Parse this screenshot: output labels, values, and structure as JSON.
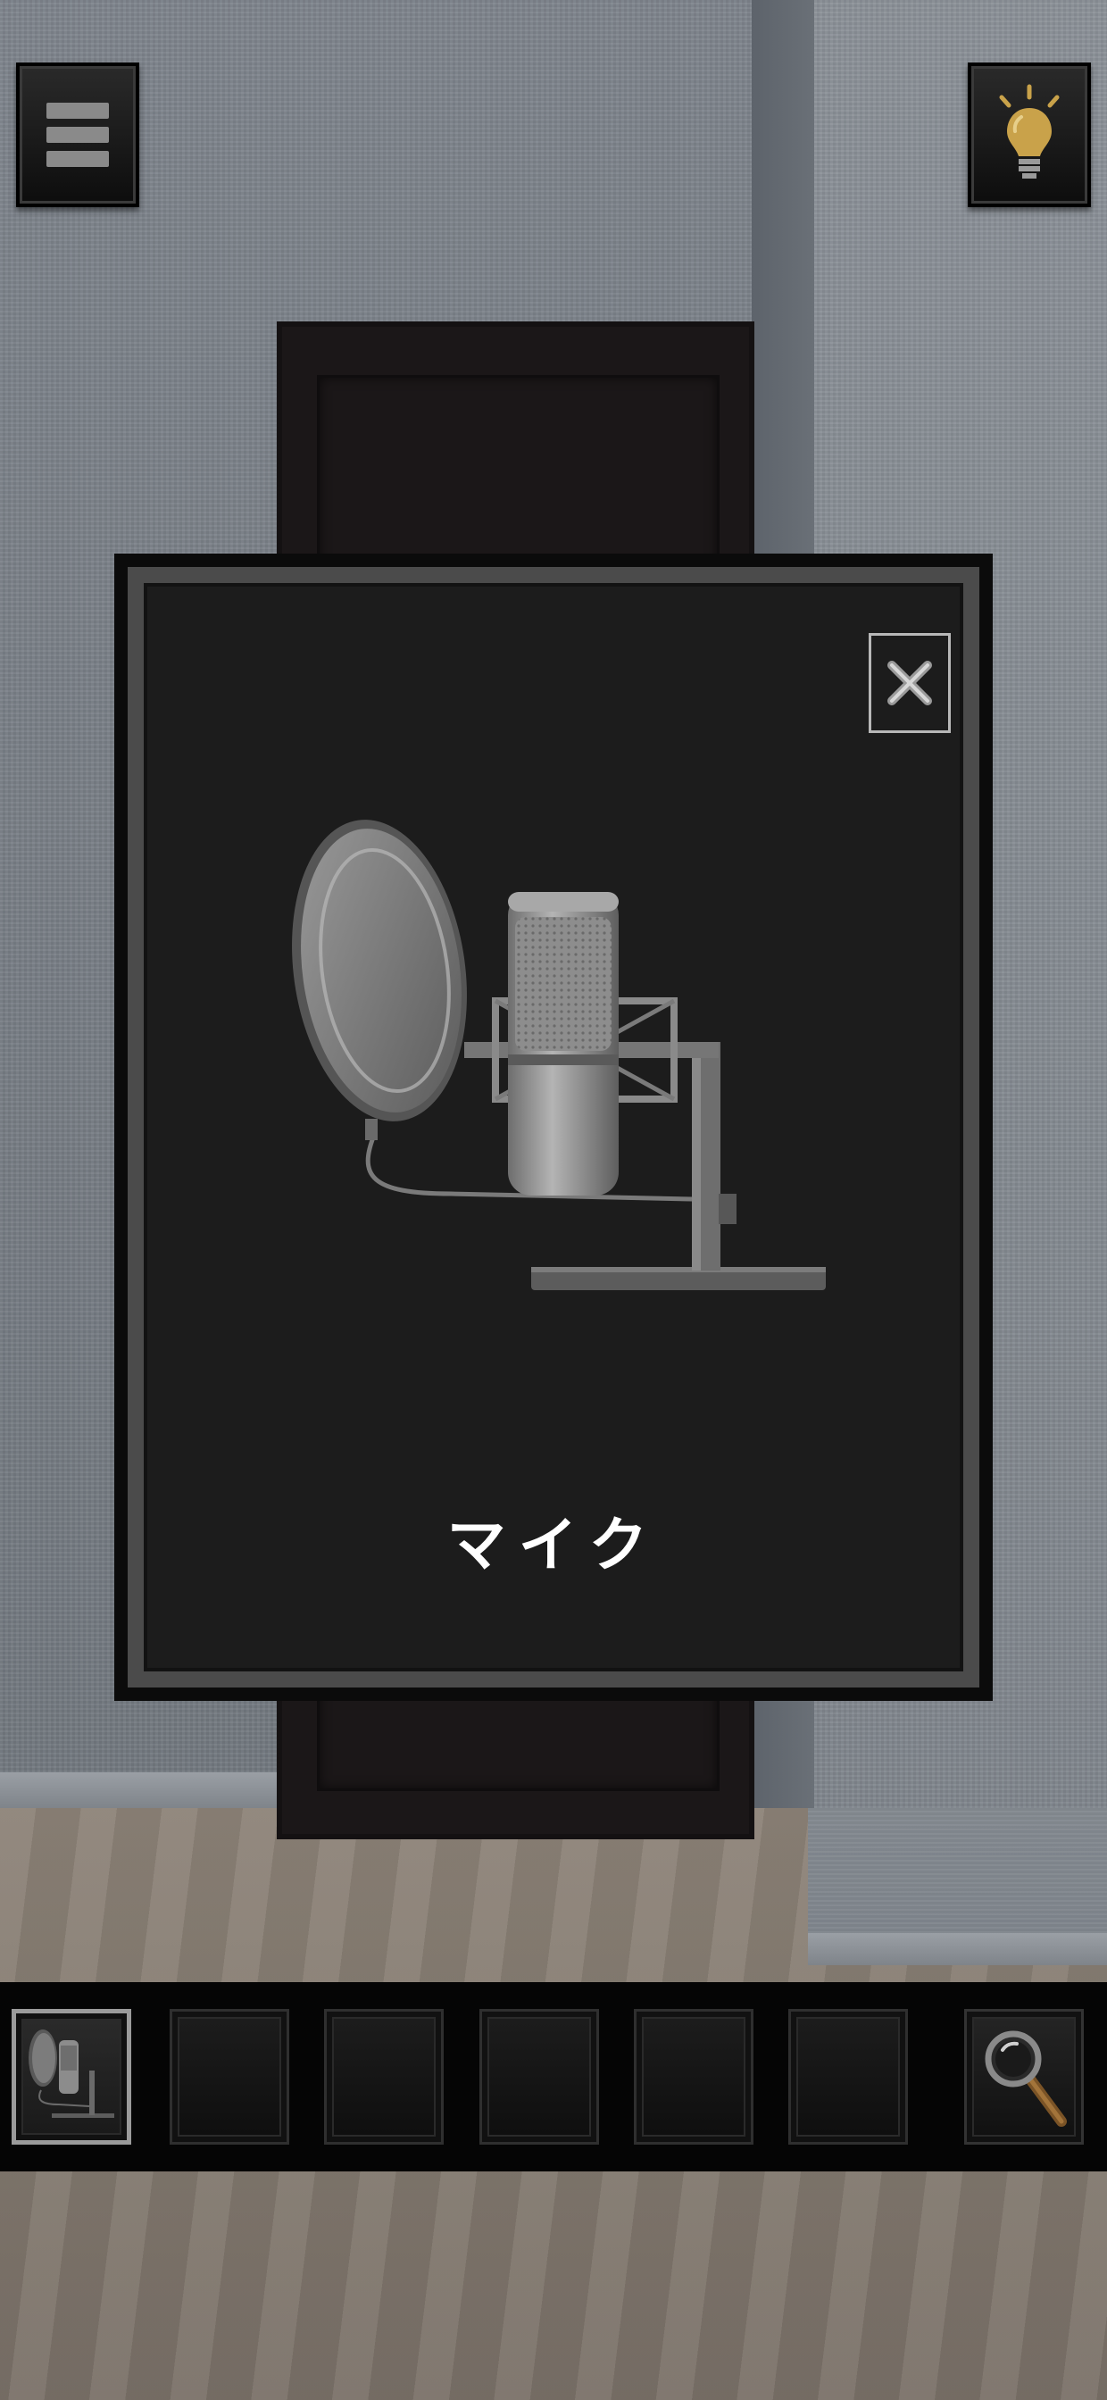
{
  "popup": {
    "item_name": "マイク",
    "item_icon": "microphone-icon"
  },
  "toolbar": {
    "menu_icon": "menu-icon",
    "hint_icon": "lightbulb-icon"
  },
  "inventory": {
    "slots": [
      {
        "item": "microphone-icon",
        "selected": true
      },
      {
        "item": null,
        "selected": false
      },
      {
        "item": null,
        "selected": false
      },
      {
        "item": null,
        "selected": false
      },
      {
        "item": null,
        "selected": false
      },
      {
        "item": null,
        "selected": false
      }
    ],
    "zoom_icon": "magnifier-icon"
  },
  "colors": {
    "hint_bulb": "#c9a24a",
    "popup_bg": "#1c1c1c",
    "popup_frame": "#4b4b4b"
  }
}
